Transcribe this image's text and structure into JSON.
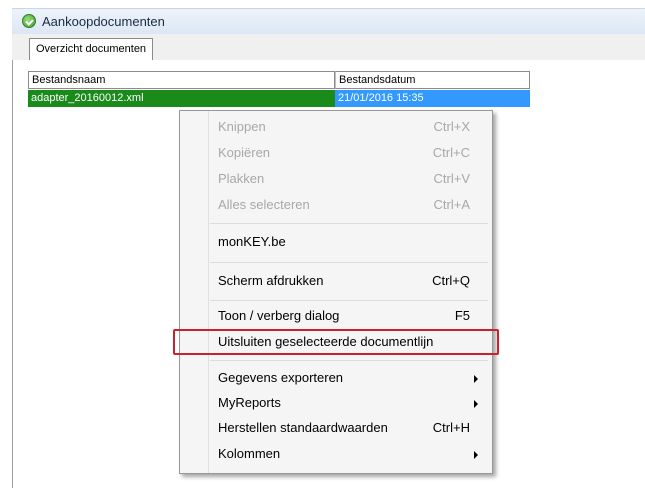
{
  "window": {
    "title": "Aankoopdocumenten"
  },
  "tabs": [
    {
      "label": "Overzicht documenten"
    }
  ],
  "grid": {
    "columns": [
      "Bestandsnaam",
      "Bestandsdatum"
    ],
    "rows": [
      {
        "name": "adapter_20160012.xml",
        "date": "21/01/2016 15:35"
      }
    ]
  },
  "context_menu": {
    "items": [
      {
        "label": "Knippen",
        "shortcut": "Ctrl+X"
      },
      {
        "label": "Kopiëren",
        "shortcut": "Ctrl+C"
      },
      {
        "label": "Plakken",
        "shortcut": "Ctrl+V"
      },
      {
        "label": "Alles selecteren",
        "shortcut": "Ctrl+A"
      },
      {
        "label": "monKEY.be",
        "shortcut": ""
      },
      {
        "label": "Scherm afdrukken",
        "shortcut": "Ctrl+Q"
      },
      {
        "label": "Toon / verberg dialog",
        "shortcut": "F5"
      },
      {
        "label": "Uitsluiten geselecteerde documentlijn",
        "shortcut": ""
      },
      {
        "label": "Gegevens exporteren",
        "shortcut": ""
      },
      {
        "label": "MyReports",
        "shortcut": ""
      },
      {
        "label": "Herstellen standaardwaarden",
        "shortcut": "Ctrl+H"
      },
      {
        "label": "Kolommen",
        "shortcut": ""
      }
    ]
  },
  "colors": {
    "selected_row": "#1a8a1a",
    "selected_cell": "#3399ff",
    "highlight_box": "#c8222a"
  }
}
